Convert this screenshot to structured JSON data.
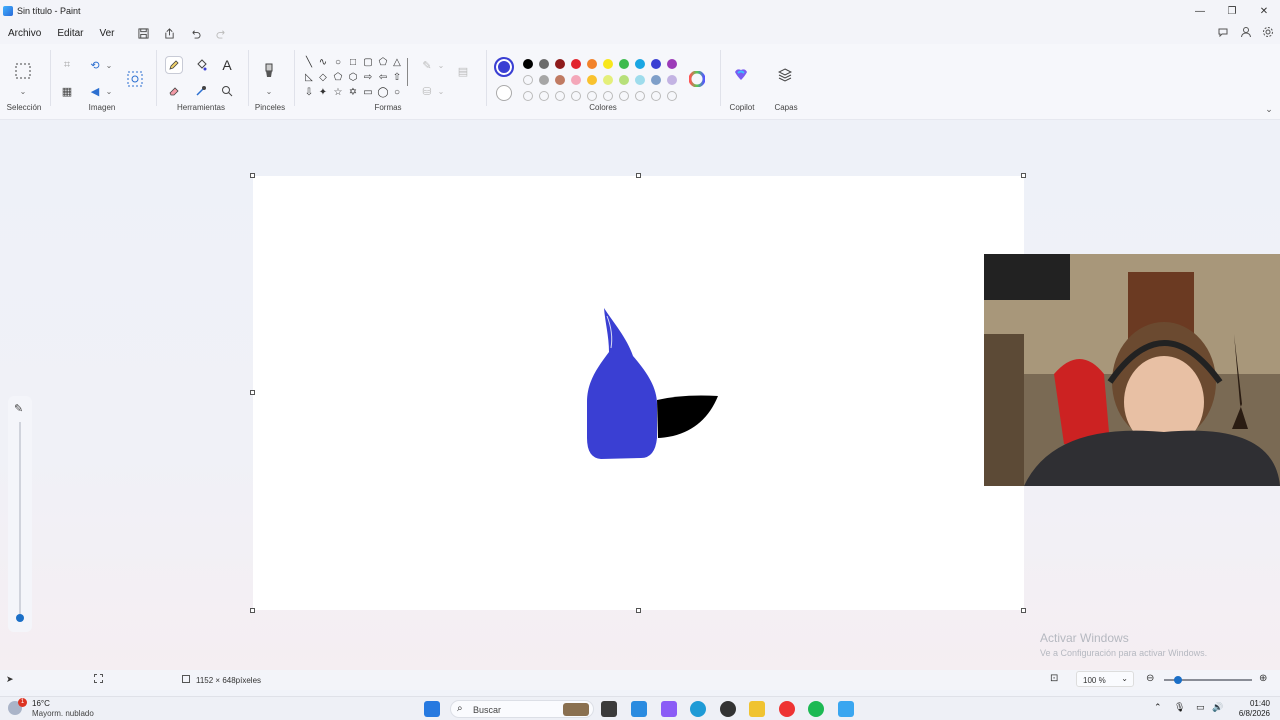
{
  "window": {
    "title": "Sin título - Paint",
    "controls": [
      "—",
      "❐",
      "✕"
    ]
  },
  "menu": {
    "items": [
      "Archivo",
      "Editar",
      "Ver"
    ],
    "icons": [
      "save-icon",
      "share-icon",
      "undo-icon",
      "redo-icon"
    ],
    "right_icons": [
      "feedback-icon",
      "account-icon",
      "settings-icon"
    ]
  },
  "ribbon": {
    "groups": {
      "selection": "Selección",
      "image": "Imagen",
      "tools": "Herramientas",
      "brushes": "Pinceles",
      "shapes": "Formas",
      "colors": "Colores",
      "copilot": "Copilot",
      "layers": "Capas"
    },
    "active_tool": "pencil",
    "primary_color": "#3a3fd3",
    "secondary_color": "#ffffff",
    "palette_row1": [
      "#000000",
      "#6b6b6b",
      "#8e1b1b",
      "#e2242d",
      "#f2822a",
      "#f8e71c",
      "#3dbb4d",
      "#1aa6e3",
      "#3a3fd3",
      "#9c3bb8"
    ],
    "palette_row2": [
      "",
      "#a6a6a6",
      "#c07a62",
      "#f4a7b9",
      "#f9c22e",
      "#e4ef7a",
      "#b7e07a",
      "#9edcec",
      "#7f9fc9",
      "#c3b3e3"
    ],
    "palette_row3": [
      "",
      "",
      "",
      "",
      "",
      "",
      "",
      "",
      "",
      ""
    ]
  },
  "status": {
    "canvas_size": "1152 × 648píxeles",
    "zoom": "100 %"
  },
  "watermark": {
    "title": "Activar Windows",
    "subtitle": "Ve a Configuración para activar Windows."
  },
  "taskbar": {
    "weather_temp": "16°C",
    "weather_desc": "Mayorm. nublado",
    "weather_badge": "1",
    "search_placeholder": "Buscar",
    "time": "01:40",
    "date": "6/8/2026"
  }
}
